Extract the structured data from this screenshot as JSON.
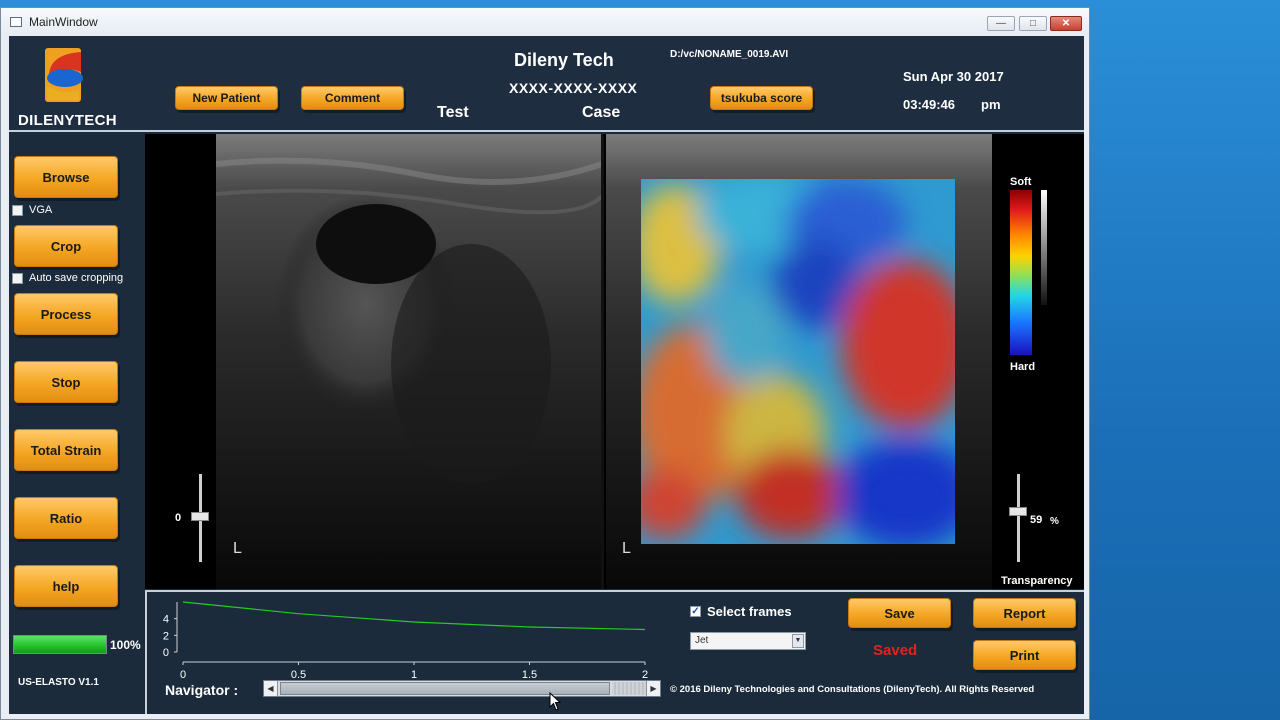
{
  "window": {
    "title": "MainWindow"
  },
  "header": {
    "brand": "DILENYTECH",
    "company": "Dileny Tech",
    "file_path": "D:/vc/NONAME_0019.AVI",
    "patient_id": "XXXX-XXXX-XXXX",
    "test_label": "Test",
    "case_label": "Case",
    "date": "Sun Apr 30 2017",
    "time": "03:49:46",
    "ampm": "pm",
    "new_patient_label": "New Patient",
    "comment_label": "Comment",
    "tsukuba_label": "tsukuba score"
  },
  "sidebar": {
    "browse_label": "Browse",
    "vga_label": "VGA",
    "crop_label": "Crop",
    "auto_save_label": "Auto save cropping",
    "process_label": "Process",
    "stop_label": "Stop",
    "total_strain_label": "Total Strain",
    "ratio_label": "Ratio",
    "help_label": "help",
    "progress_value": 100,
    "progress_text": "100%",
    "version": "US-ELASTO V1.1"
  },
  "viewer": {
    "left_slider_value": "0",
    "transparency_value": "59",
    "transparency_unit": "%",
    "transparency_label": "Transparency",
    "soft_label": "Soft",
    "hard_label": "Hard",
    "marker_left": "L",
    "marker_right": "L"
  },
  "bottom": {
    "select_frames_label": "Select frames",
    "colormap_value": "Jet",
    "save_label": "Save",
    "saved_status": "Saved",
    "report_label": "Report",
    "print_label": "Print",
    "navigator_label": "Navigator :",
    "copyright": "© 2016 Dileny Technologies and Consultations (DilenyTech). All Rights Reserved"
  },
  "chart_data": {
    "type": "line",
    "x_ticks": [
      "0",
      "0.5",
      "1",
      "1.5",
      "2"
    ],
    "y_ticks": [
      "4",
      "2",
      "0"
    ],
    "xlim": [
      0,
      2
    ],
    "ylim": [
      0,
      6
    ],
    "series": [
      {
        "color": "#22cc22",
        "x": [
          0,
          0.5,
          1,
          1.5,
          2
        ],
        "y": [
          6.0,
          4.6,
          3.6,
          3.0,
          2.7
        ]
      }
    ]
  },
  "colors": {
    "accent": "#f5a623",
    "saved": "#e0231b",
    "progress": "#22c22a",
    "panel": "#1b2b3c"
  }
}
